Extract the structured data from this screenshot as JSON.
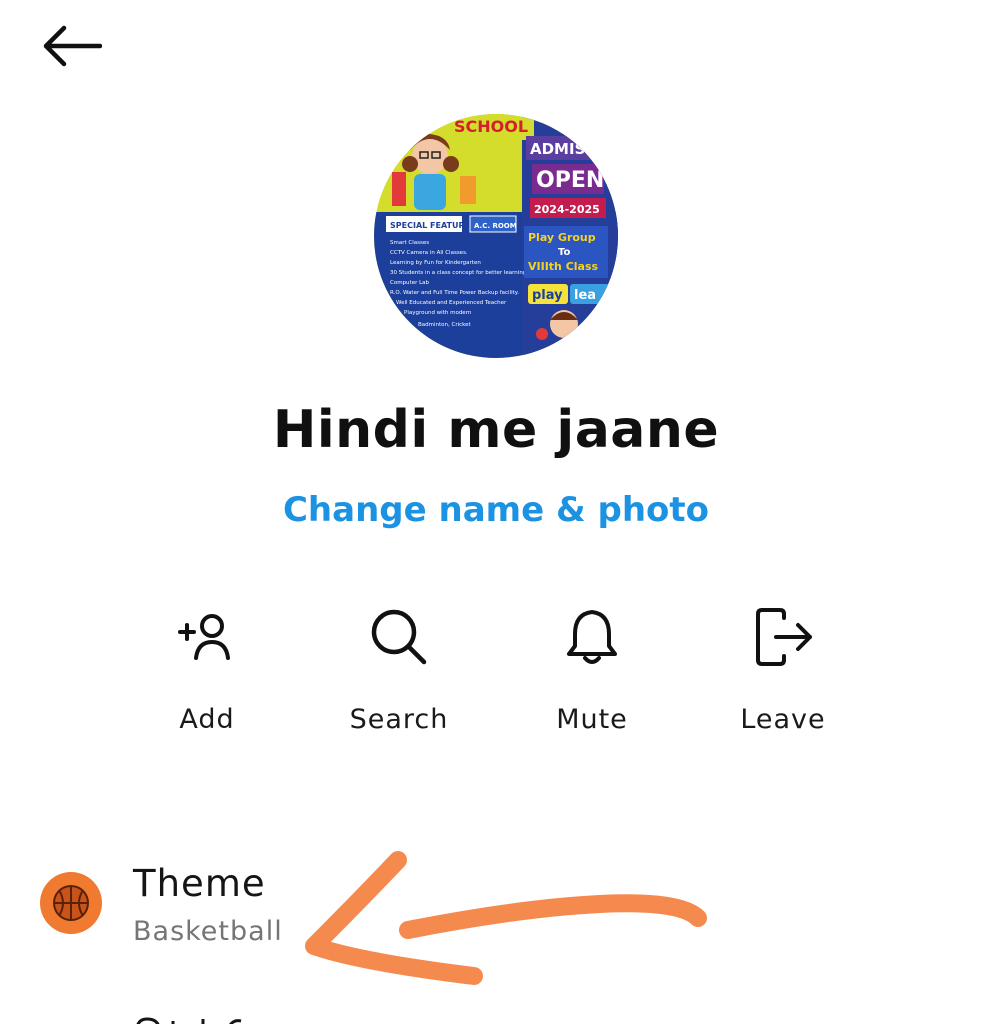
{
  "header": {
    "back_icon": "arrow-left-icon"
  },
  "group": {
    "avatar": {
      "school_title": "SCHOOL",
      "admission": "ADMISS",
      "open": "OPEN",
      "session": "2024-2025",
      "special_features": "SPECIAL FEATURES",
      "ac_room": "A.C. ROOM",
      "play_group": "Play Group",
      "to": "To",
      "class_range": "VIIIth Class",
      "play": "play",
      "learn": "lea",
      "features": [
        "Smart Classes",
        "CCTV Camera in All Classes.",
        "Learning by Fun for Kindergarten",
        "30 Students in a class concept for better learning",
        "Computer Lab",
        "R.O. Water and Full Time Power Backup facility.",
        "Well Educated and Experienced Teacher",
        "Playground with modern",
        "Badminton, Cricket"
      ]
    },
    "name": "Hindi me jaane",
    "change_link": "Change name & photo"
  },
  "actions": [
    {
      "label": "Add",
      "icon": "add-person-icon"
    },
    {
      "label": "Search",
      "icon": "search-icon"
    },
    {
      "label": "Mute",
      "icon": "bell-icon"
    },
    {
      "label": "Leave",
      "icon": "leave-icon"
    }
  ],
  "settings": {
    "theme": {
      "title": "Theme",
      "value": "Basketball",
      "icon": "basketball-icon"
    }
  },
  "colors": {
    "link": "#1c93e2",
    "theme_icon_bg": "#f07a30",
    "annotation_arrow": "#f58a4e"
  }
}
